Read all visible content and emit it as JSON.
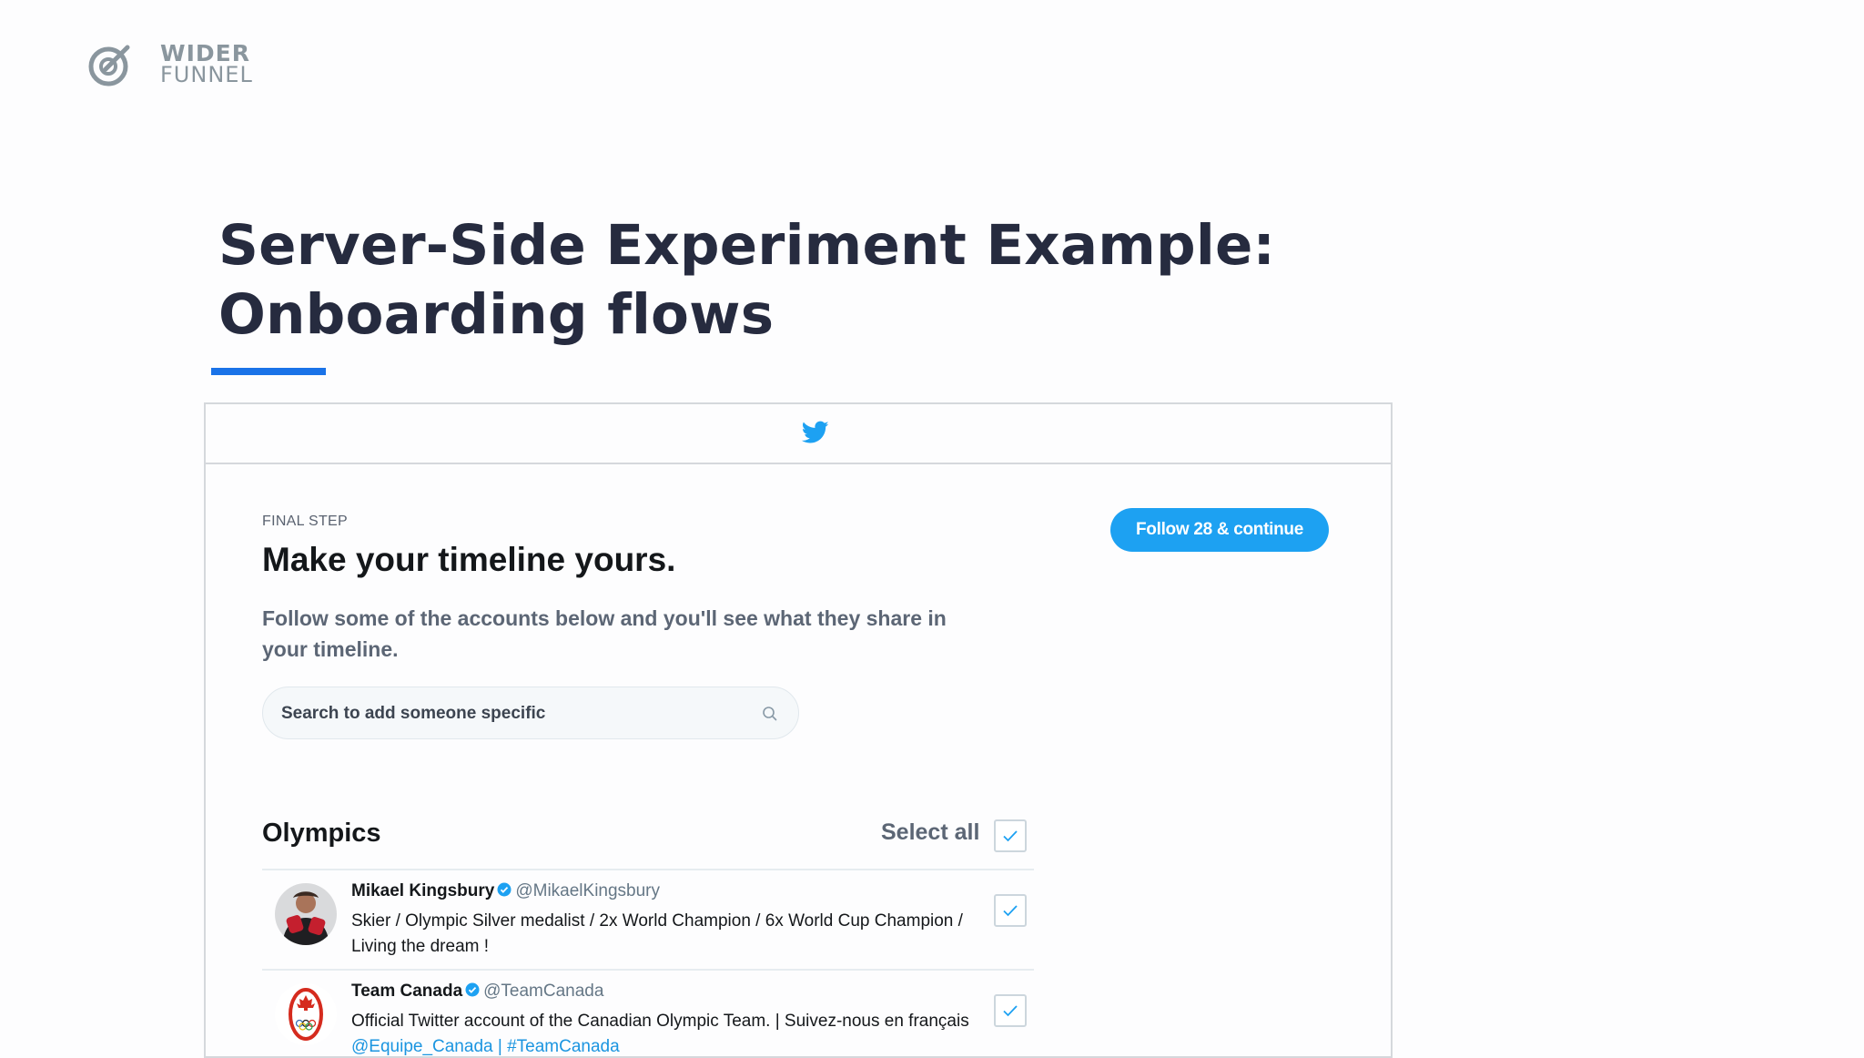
{
  "slide": {
    "logo_top": "WIDER",
    "logo_bottom": "FUNNEL",
    "title_line1": "Server-Side Experiment Example:",
    "title_line2": "Onboarding flows",
    "accent_color": "#1a73e8"
  },
  "onboarding": {
    "step_label": "FINAL STEP",
    "headline": "Make your timeline yours.",
    "subtext": "Follow some of the accounts below and you'll see what they share in your timeline.",
    "follow_button": "Follow 28 & continue",
    "search_placeholder": "Search to add someone specific",
    "brand_color": "#1da1f2",
    "group": {
      "title": "Olympics",
      "select_all_label": "Select all",
      "select_all_checked": true
    },
    "accounts": [
      {
        "name": "Mikael Kingsbury",
        "handle": "@MikaelKingsbury",
        "bio": "Skier / Olympic Silver medalist / 2x World Champion / 6x World Cup Champion / Living the dream !",
        "verified": true,
        "checked": true
      },
      {
        "name": "Team Canada",
        "handle": "@TeamCanada",
        "bio": "Official Twitter account of the Canadian Olympic Team. | Suivez-nous en français",
        "bio_links": "@Equipe_Canada | #TeamCanada",
        "verified": true,
        "checked": true
      }
    ]
  }
}
